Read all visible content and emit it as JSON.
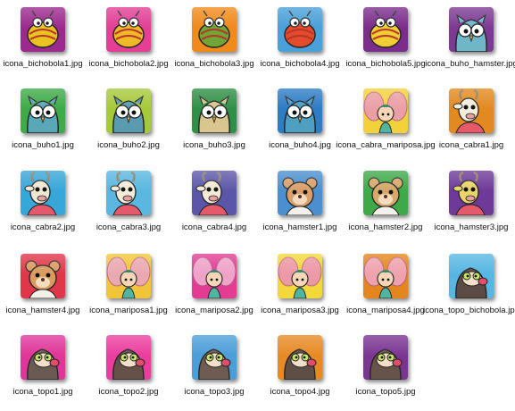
{
  "files": [
    {
      "name": "icona_bichobola1.jpg",
      "bg": "#9b2a8e",
      "char": "bug",
      "color": "#e9c31f",
      "icon": "bug-thumbnail-icon"
    },
    {
      "name": "icona_bichobola2.jpg",
      "bg": "#e23f95",
      "char": "bug",
      "color": "#f0b928",
      "icon": "bug-thumbnail-icon"
    },
    {
      "name": "icona_bichobola3.jpg",
      "bg": "#f08a1c",
      "char": "bug",
      "color": "#6fa636",
      "icon": "bug-thumbnail-icon"
    },
    {
      "name": "icona_bichobola4.jpg",
      "bg": "#4aa0d8",
      "char": "bug",
      "color": "#e44a2c",
      "icon": "bug-thumbnail-icon"
    },
    {
      "name": "icona_bichobola5.jpg",
      "bg": "#7b2d8c",
      "char": "bug",
      "color": "#f1cf34",
      "icon": "bug-thumbnail-icon"
    },
    {
      "name": "icona_buho_hamster.jpg",
      "bg": "#7d3a92",
      "char": "owl",
      "color": "#6fb6c8",
      "icon": "owl-hamster-thumbnail-icon"
    },
    {
      "name": "icona_buho1.jpg",
      "bg": "#3eaa48",
      "char": "owl",
      "color": "#5aa7b8",
      "icon": "owl-thumbnail-icon"
    },
    {
      "name": "icona_buho2.jpg",
      "bg": "#a6c93a",
      "char": "owl",
      "color": "#5b9bb0",
      "icon": "owl-thumbnail-icon"
    },
    {
      "name": "icona_buho3.jpg",
      "bg": "#2f8f46",
      "char": "owl",
      "color": "#d8c68e",
      "icon": "owl-thumbnail-icon"
    },
    {
      "name": "icona_buho4.jpg",
      "bg": "#2e7cc4",
      "char": "owl",
      "color": "#4e9fc2",
      "icon": "owl-thumbnail-icon"
    },
    {
      "name": "icona_cabra_mariposa.jpg",
      "bg": "#f3d13a",
      "char": "fairy",
      "color": "#e897b9",
      "icon": "goat-butterfly-thumbnail-icon"
    },
    {
      "name": "icona_cabra1.jpg",
      "bg": "#e28a1f",
      "char": "goat",
      "color": "#f2eddd",
      "icon": "goat-thumbnail-icon"
    },
    {
      "name": "icona_cabra2.jpg",
      "bg": "#37a6d8",
      "char": "goat",
      "color": "#f0e7d2",
      "icon": "goat-thumbnail-icon"
    },
    {
      "name": "icona_cabra3.jpg",
      "bg": "#59b7e0",
      "char": "goat",
      "color": "#f4ebd8",
      "icon": "goat-pirate-thumbnail-icon"
    },
    {
      "name": "icona_cabra4.jpg",
      "bg": "#5b57a8",
      "char": "goat",
      "color": "#f3e9d6",
      "icon": "goat-hat-thumbnail-icon"
    },
    {
      "name": "icona_hamster1.jpg",
      "bg": "#4b8fcf",
      "char": "hamster",
      "color": "#d9a06b",
      "icon": "hamster-thumbnail-icon"
    },
    {
      "name": "icona_hamster2.jpg",
      "bg": "#3fa94a",
      "char": "hamster",
      "color": "#d6a86a",
      "icon": "hamster-thumbnail-icon"
    },
    {
      "name": "icona_hamster3.jpg",
      "bg": "#6d3a98",
      "char": "goat",
      "color": "#e8d46a",
      "icon": "goat-goggles-thumbnail-icon"
    },
    {
      "name": "icona_hamster4.jpg",
      "bg": "#e0364a",
      "char": "hamster",
      "color": "#d99b5e",
      "icon": "hamster-thumbnail-icon"
    },
    {
      "name": "icona_mariposa1.jpg",
      "bg": "#f1c53a",
      "char": "fairy",
      "color": "#e9a3c6",
      "icon": "butterfly-fairy-thumbnail-icon"
    },
    {
      "name": "icona_mariposa2.jpg",
      "bg": "#e33d93",
      "char": "fairy",
      "color": "#f1b6d3",
      "icon": "butterfly-fairy-thumbnail-icon"
    },
    {
      "name": "icona_mariposa3.jpg",
      "bg": "#f2d83a",
      "char": "fairy",
      "color": "#ec8fba",
      "icon": "butterfly-fairy-thumbnail-icon"
    },
    {
      "name": "icona_mariposa4.jpg",
      "bg": "#e4861e",
      "char": "fairy",
      "color": "#f0a7c8",
      "icon": "butterfly-fairy-thumbnail-icon"
    },
    {
      "name": "icona_topo_bichobola.jpg",
      "bg": "#57b7e2",
      "char": "mole",
      "color": "#5c4b44",
      "icon": "mole-bug-thumbnail-icon"
    },
    {
      "name": "icona_topo1.jpg",
      "bg": "#e0369a",
      "char": "mole",
      "color": "#6b5a52",
      "icon": "mole-thumbnail-icon"
    },
    {
      "name": "icona_topo2.jpg",
      "bg": "#ea3e9e",
      "char": "mole",
      "color": "#655148",
      "icon": "mole-thumbnail-icon"
    },
    {
      "name": "icona_topo3.jpg",
      "bg": "#4b9ed8",
      "char": "mole",
      "color": "#6e5c52",
      "icon": "mole-thumbnail-icon"
    },
    {
      "name": "icona_topo4.jpg",
      "bg": "#e78a24",
      "char": "mole",
      "color": "#5f4e46",
      "icon": "mole-thumbnail-icon"
    },
    {
      "name": "icona_topo5.jpg",
      "bg": "#7a3592",
      "char": "mole",
      "color": "#66544b",
      "icon": "mole-thumbnail-icon"
    }
  ]
}
